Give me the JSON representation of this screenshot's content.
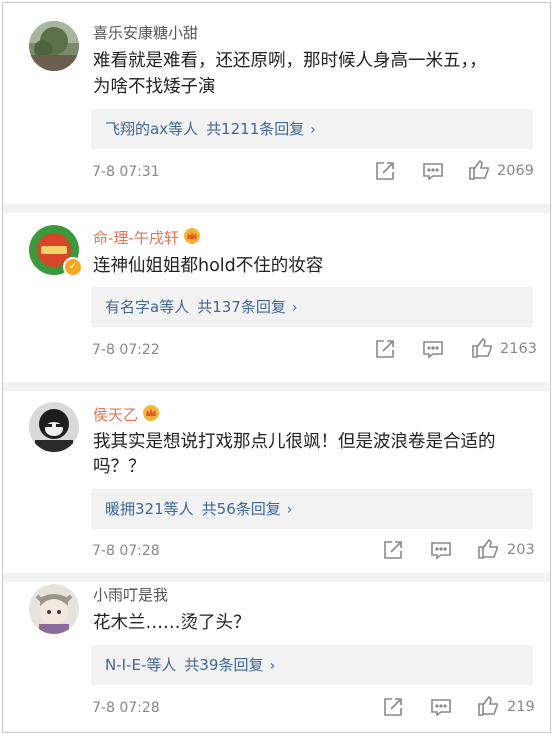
{
  "comments": [
    {
      "username": "喜乐安康糖小甜",
      "text_lines": [
        "难看就是难看，还还原咧，那时候人身高一米五，，",
        "为啥不找矮子演"
      ],
      "reply_user": "飞翔的ax",
      "reply_etc": "等人",
      "reply_count": "共1211条回复",
      "time": "7-8 07:31",
      "likes": "2069"
    },
    {
      "username": "命-理-午戌轩",
      "text_lines": [
        "连神仙姐姐都hold不住的妆容"
      ],
      "reply_user": "有名字a",
      "reply_etc": "等人",
      "reply_count": "共137条回复",
      "time": "7-8 07:22",
      "likes": "2163"
    },
    {
      "username": "侯天乙",
      "text_lines": [
        "我其实是想说打戏那点儿很飒！但是波浪卷是合适的",
        "吗？？"
      ],
      "reply_user": "暖拥321",
      "reply_etc": "等人",
      "reply_count": "共56条回复",
      "time": "7-8 07:28",
      "likes": "203"
    },
    {
      "username": "小雨叮是我",
      "text_lines": [
        "花木兰……烫了头？"
      ],
      "reply_user": "N-I-E-",
      "reply_etc": "等人",
      "reply_count": "共39条回复",
      "time": "7-8 07:28",
      "likes": "219"
    }
  ],
  "glyphs": {
    "chevron": "›"
  },
  "colors": {
    "vip_name": "#eb7350",
    "link": "#3f6796",
    "meta": "#888888",
    "separator": "#f2f2f2"
  },
  "icons": [
    "share-icon",
    "comment-icon",
    "like-icon",
    "crown-badge-icon",
    "verified-badge-icon"
  ]
}
